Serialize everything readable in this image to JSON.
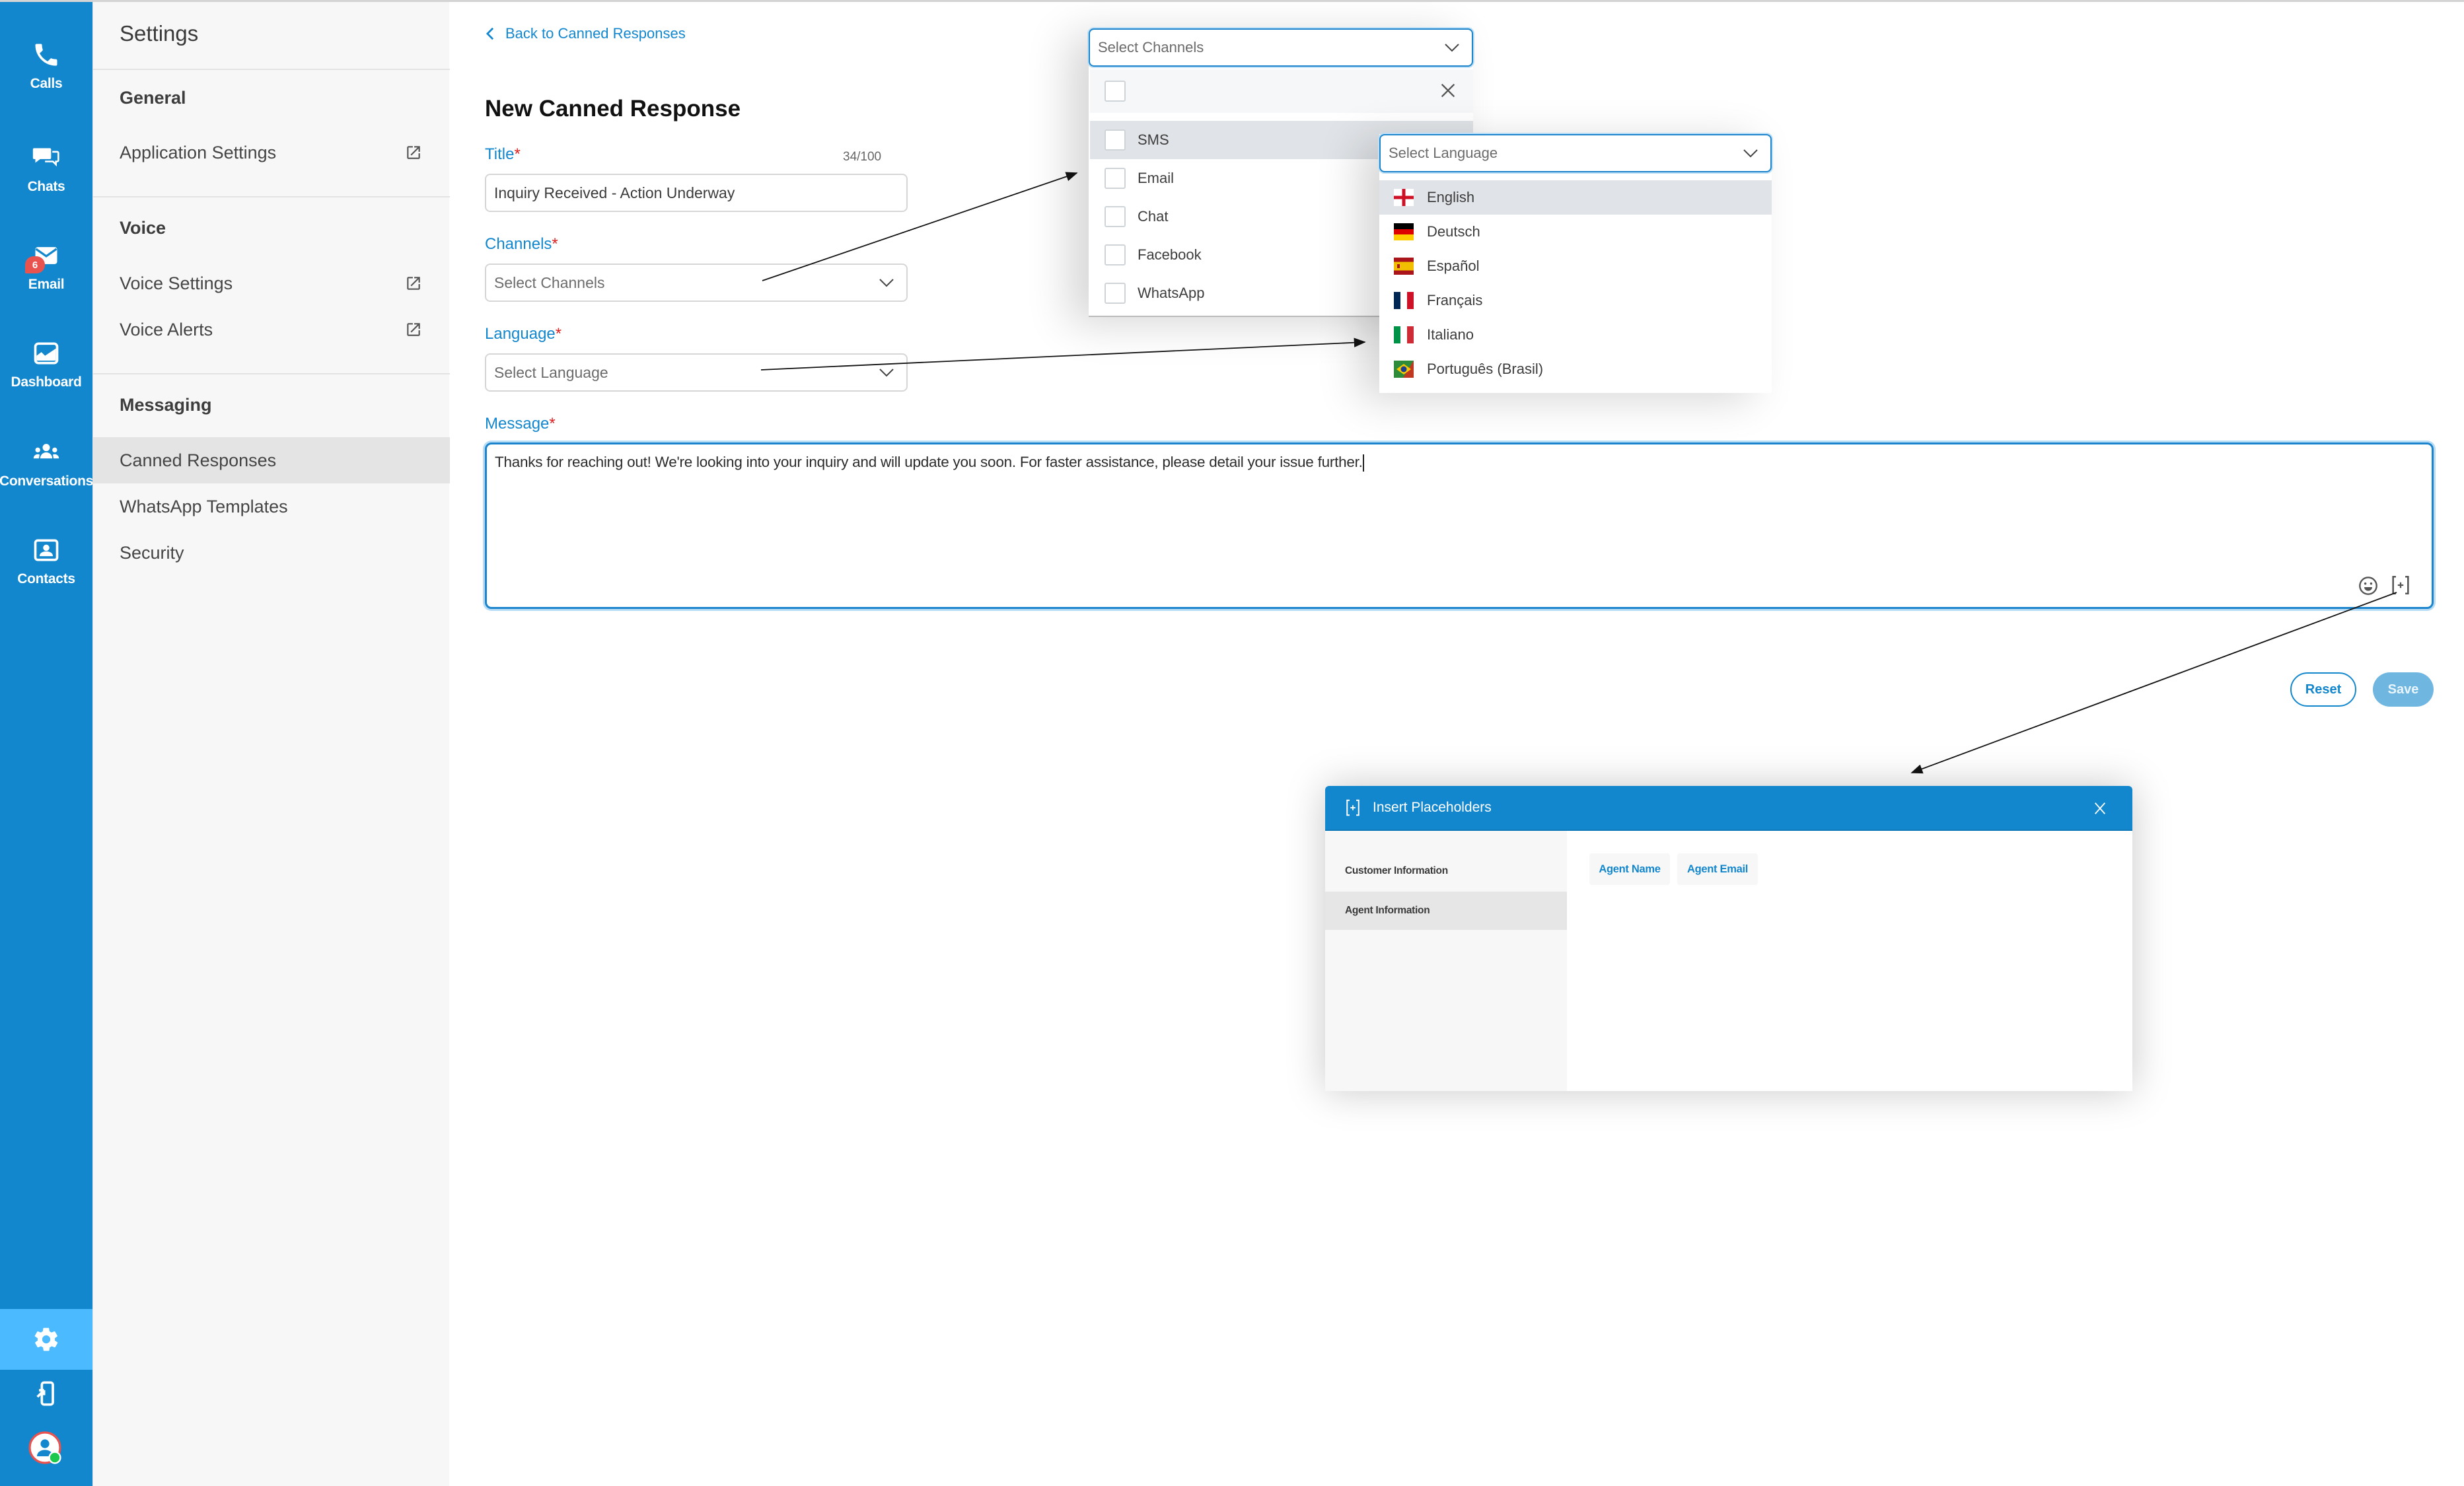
{
  "nav": {
    "items": [
      {
        "label": "Calls",
        "icon": "phone-icon"
      },
      {
        "label": "Chats",
        "icon": "chat-bubbles-icon"
      },
      {
        "label": "Email",
        "icon": "envelope-icon",
        "badge": "6"
      },
      {
        "label": "Dashboard",
        "icon": "chart-icon"
      },
      {
        "label": "Conversations",
        "icon": "group-icon"
      },
      {
        "label": "Contacts",
        "icon": "contact-card-icon"
      }
    ],
    "bottom": [
      {
        "name": "settings",
        "icon": "gear-icon",
        "active": true
      },
      {
        "name": "login-device",
        "icon": "device-login-icon"
      },
      {
        "name": "user-status",
        "icon": "user-avatar-icon",
        "status": "online"
      }
    ]
  },
  "settings": {
    "title": "Settings",
    "sections": [
      {
        "heading": "General",
        "items": [
          {
            "label": "Application Settings",
            "external": true
          }
        ]
      },
      {
        "heading": "Voice",
        "items": [
          {
            "label": "Voice Settings",
            "external": true
          },
          {
            "label": "Voice Alerts",
            "external": true
          }
        ]
      },
      {
        "heading": "Messaging",
        "items": [
          {
            "label": "Canned Responses",
            "active": true
          },
          {
            "label": "WhatsApp Templates"
          },
          {
            "label": "Security"
          }
        ]
      }
    ]
  },
  "form": {
    "back_label": "Back to Canned Responses",
    "page_title": "New Canned Response",
    "title_label": "Title",
    "title_counter": "34/100",
    "title_value": "Inquiry Received - Action Underway",
    "channels_label": "Channels",
    "channels_placeholder": "Select Channels",
    "language_label": "Language",
    "language_placeholder": "Select Language",
    "message_label": "Message",
    "message_value": "Thanks for reaching out! We're looking into your inquiry and will update you soon. For faster assistance, please detail your issue further.",
    "required_mark": "*",
    "reset_label": "Reset",
    "save_label": "Save"
  },
  "channels_dropdown": {
    "placeholder": "Select Channels",
    "options": [
      "SMS",
      "Email",
      "Chat",
      "Facebook",
      "WhatsApp"
    ],
    "highlighted": "SMS"
  },
  "language_dropdown": {
    "placeholder": "Select Language",
    "options": [
      {
        "label": "English",
        "flag": "england"
      },
      {
        "label": "Deutsch",
        "flag": "germany"
      },
      {
        "label": "Español",
        "flag": "spain"
      },
      {
        "label": "Français",
        "flag": "france"
      },
      {
        "label": "Italiano",
        "flag": "italy"
      },
      {
        "label": "Português (Brasil)",
        "flag": "portugal-brazil"
      }
    ],
    "highlighted": "English"
  },
  "placeholders_modal": {
    "title": "Insert Placeholders",
    "tabs": [
      "Customer Information",
      "Agent Information"
    ],
    "active_tab": "Agent Information",
    "chips": [
      "Agent Name",
      "Agent Email"
    ]
  },
  "colors": {
    "brand": "#1387ce",
    "nav_active": "#4bbaff",
    "required": "#e01e1e",
    "badge": "#e8534f",
    "online": "#1ec84c"
  }
}
